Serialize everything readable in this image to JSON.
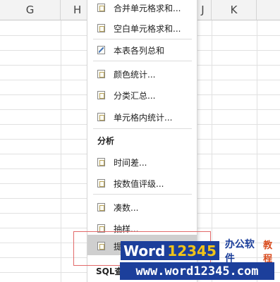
{
  "columns": {
    "g": "G",
    "h": "H",
    "j": "J",
    "k": "K"
  },
  "menu": {
    "items_top": [
      {
        "label": "合并单元格求和...",
        "icon": "spreadsheet-icon"
      },
      {
        "label": "空白单元格求和...",
        "icon": "spreadsheet-icon"
      },
      {
        "label": "本表各列总和",
        "icon": "sum-icon"
      },
      {
        "label": "颜色统计...",
        "icon": "spreadsheet-icon"
      },
      {
        "label": "分类汇总...",
        "icon": "spreadsheet-icon"
      },
      {
        "label": "单元格内统计...",
        "icon": "spreadsheet-icon"
      }
    ],
    "section_analysis": "分析",
    "items_analysis": [
      {
        "label": "时间差...",
        "icon": "spreadsheet-icon"
      },
      {
        "label": "按数值评级...",
        "icon": "spreadsheet-icon"
      },
      {
        "label": "凑数...",
        "icon": "spreadsheet-icon"
      },
      {
        "label": "抽样...",
        "icon": "spreadsheet-icon"
      },
      {
        "label": "提",
        "icon": "spreadsheet-icon"
      }
    ],
    "sql_partial": "SQL查"
  },
  "watermark": {
    "word": "Word",
    "number": "12345",
    "office_text": "办公软件",
    "tutorial_text": "教程",
    "url": "www.word12345.com"
  },
  "colors": {
    "highlight": "#cfcfcf",
    "annotation_red": "#e26a6a",
    "watermark_blue": "#1c3f9b",
    "watermark_yellow": "#f0c419"
  }
}
